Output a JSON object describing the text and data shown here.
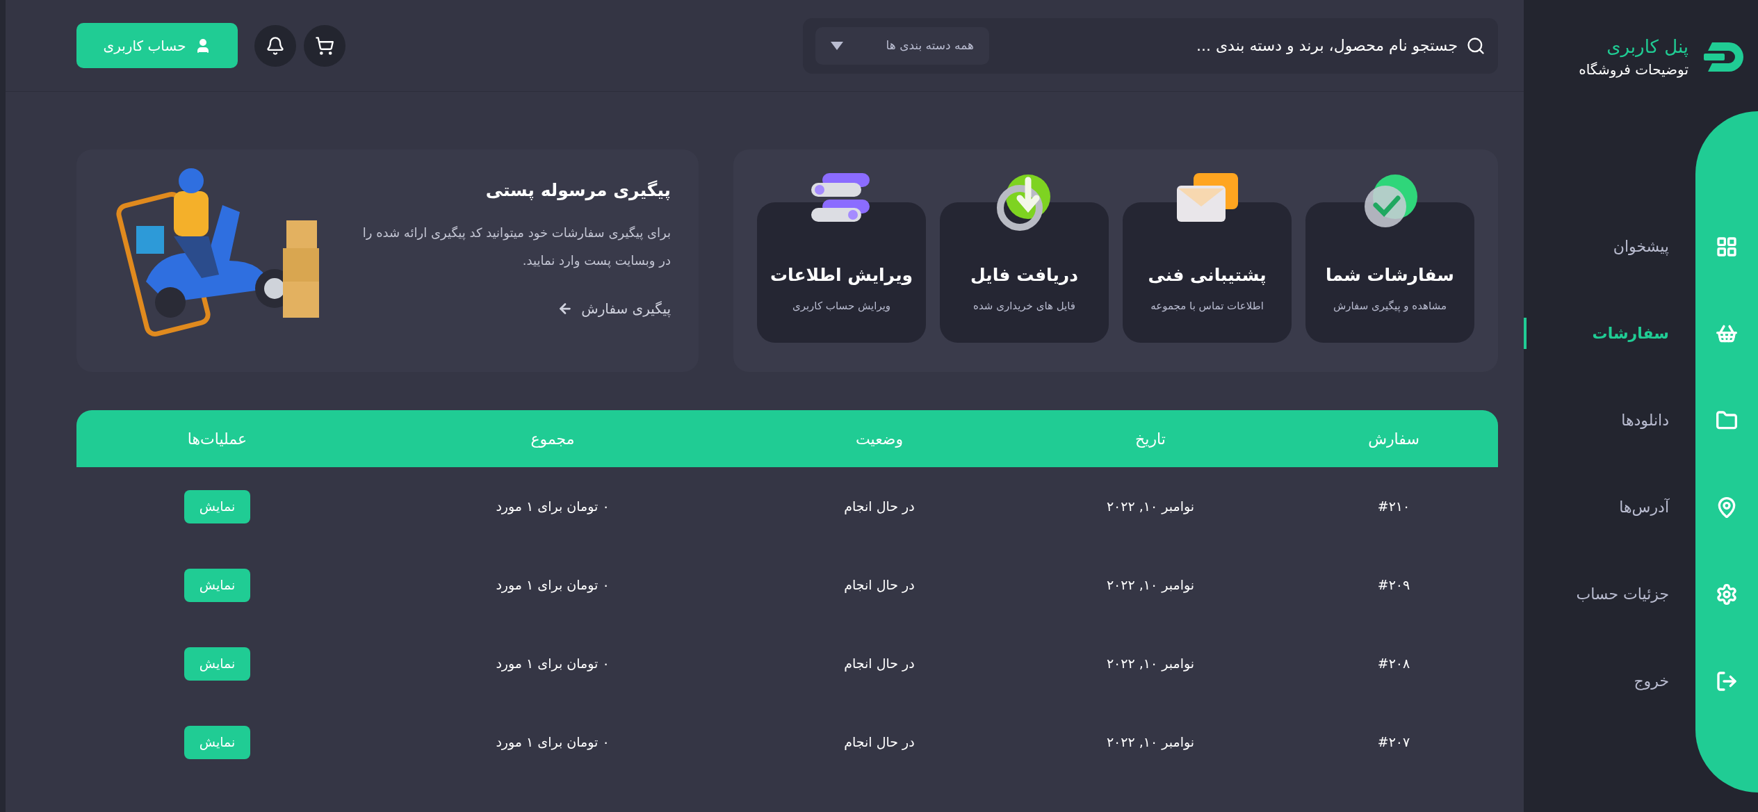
{
  "sidebar": {
    "logo": {
      "title": "پنل کاربری",
      "subtitle": "توضیحات فروشگاه"
    },
    "items": [
      {
        "label": "پیشخوان",
        "selected": false
      },
      {
        "label": "سفارشات",
        "selected": true
      },
      {
        "label": "دانلودها",
        "selected": false
      },
      {
        "label": "آدرس‌ها",
        "selected": false
      },
      {
        "label": "جزئیات حساب",
        "selected": false
      },
      {
        "label": "خروج",
        "selected": false
      }
    ]
  },
  "header": {
    "search": {
      "placeholder": "جستجو نام محصول، برند و دسته بندی ..."
    },
    "category": "همه دسته بندی ها",
    "account_button": "حساب کاربری"
  },
  "quick_links": [
    {
      "title": "سفارشات شما",
      "subtitle": "مشاهده و پیگیری سفارش"
    },
    {
      "title": "پشتیبانی فنی",
      "subtitle": "اطلاعات تماس با مجموعه"
    },
    {
      "title": "دریافت فایل",
      "subtitle": "فایل های خریداری شده"
    },
    {
      "title": "ویرایش اطلاعات",
      "subtitle": "ویرایش حساب کاربری"
    }
  ],
  "tracking": {
    "title": "پیگیری مرسوله پستی",
    "text": "برای پیگیری سفارشات خود میتوانید کد پیگیری ارائه شده را در وبسایت پست وارد نمایید.",
    "link": "پیگیری سفارش"
  },
  "table": {
    "columns": [
      "سفارش",
      "تاریخ",
      "وضعیت",
      "مجموع",
      "عملیات‌ها"
    ],
    "rows": [
      {
        "order": "#۲۱۰",
        "date": "نوامبر ۱۰, ۲۰۲۲",
        "status": "در حال انجام",
        "total": "۰ تومان برای ۱ مورد",
        "action": "نمایش"
      },
      {
        "order": "#۲۰۹",
        "date": "نوامبر ۱۰, ۲۰۲۲",
        "status": "در حال انجام",
        "total": "۰ تومان برای ۱ مورد",
        "action": "نمایش"
      },
      {
        "order": "#۲۰۸",
        "date": "نوامبر ۱۰, ۲۰۲۲",
        "status": "در حال انجام",
        "total": "۰ تومان برای ۱ مورد",
        "action": "نمایش"
      },
      {
        "order": "#۲۰۷",
        "date": "نوامبر ۱۰, ۲۰۲۲",
        "status": "در حال انجام",
        "total": "۰ تومان برای ۱ مورد",
        "action": "نمایش"
      }
    ]
  }
}
